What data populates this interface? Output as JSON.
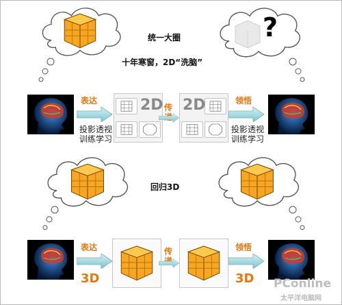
{
  "captions": {
    "title_top": "统一大圈",
    "subtitle_top": "十年寒窗，2D“洗脑”",
    "title_mid": "回归3D"
  },
  "row1": {
    "verb_left": "表达",
    "verb_right": "领悟",
    "transfer_top": "传",
    "transfer_bottom": "递",
    "label_left_line1": "投影透视",
    "label_left_line2": "训练学习",
    "label_right_line1": "投影透视",
    "label_right_line2": "训练学习",
    "mode_left": "2D",
    "mode_right": "2D"
  },
  "row2": {
    "verb_left": "表达",
    "verb_right": "领悟",
    "transfer_top": "传",
    "transfer_bottom": "递",
    "mode_left": "3D",
    "mode_right": "3D"
  },
  "question_mark": "?",
  "watermark": {
    "brand": "PConline",
    "sub": "太平洋电脑网"
  },
  "colors": {
    "accent_orange": "#e8760c",
    "arrow_teal": "#8fd0d8",
    "cube_orange": "#f5a623",
    "brain_red": "#d43a2a",
    "brain_blue": "#2d6fd1"
  }
}
